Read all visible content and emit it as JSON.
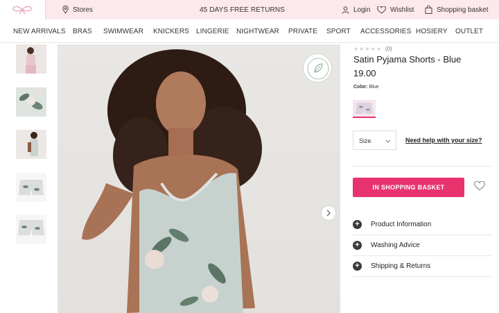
{
  "topbar": {
    "stores": "Stores",
    "returns": "45 DAYS FREE RETURNS",
    "login": "Login",
    "wishlist": "Wishlist",
    "basket": "Shopping basket"
  },
  "nav": [
    "NEW ARRIVALS",
    "BRAS",
    "SWIMWEAR",
    "KNICKERS",
    "LINGERIE",
    "NIGHTWEAR",
    "PRIVATE",
    "SPORT",
    "ACCESSORIES",
    "HOSIERY",
    "OUTLET"
  ],
  "product": {
    "review_count": "(0)",
    "rating": 0,
    "title": "Satin Pyjama Shorts - Blue",
    "price": "19.00",
    "color_label": "Color:",
    "color_value": "Blue",
    "size_label": "Size",
    "size_help": "Need help with your size?",
    "basket_button": "IN SHOPPING BASKET"
  },
  "accordion": [
    "Product Information",
    "Washing Advice",
    "Shipping & Returns"
  ],
  "colors": {
    "accent": "#e8336f",
    "topbar_bg": "#fde8ec"
  },
  "icons": {
    "logo": "bow-logo",
    "stores": "location-pin-icon",
    "login": "user-icon",
    "wishlist": "heart-icon",
    "basket": "shopping-bag-icon"
  }
}
